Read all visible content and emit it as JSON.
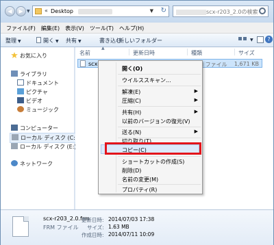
{
  "address": {
    "breadcrumb_prefix": "«",
    "location": "Desktop"
  },
  "search": {
    "placeholder_suffix": "scx-r203_2.0の検索"
  },
  "menubar": [
    "ファイル(F)",
    "編集(E)",
    "表示(V)",
    "ツール(T)",
    "ヘルプ(H)"
  ],
  "toolbar": {
    "organize": "整理",
    "open": "開く",
    "share": "共有",
    "burn": "書き込む",
    "new_folder": "新しいフォルダー"
  },
  "nav": {
    "favorites": "お気に入り",
    "libraries": "ライブラリ",
    "documents": "ドキュメント",
    "pictures": "ピクチャ",
    "videos": "ビデオ",
    "music": "ミュージック",
    "computer": "コンピューター",
    "disk_c": "ローカル ディスク (C:)",
    "disk_e": "ローカル ディスク (E:)",
    "network": "ネットワーク"
  },
  "columns": {
    "name": "名前",
    "date": "更新日時",
    "type": "種類",
    "size": "サイズ"
  },
  "file": {
    "name": "scx-r203_2.0.frm",
    "type": "FRM ファイル",
    "size": "1,671 KB"
  },
  "context_menu": {
    "open": "開く(O)",
    "virus_scan": "ウイルススキャン...",
    "extract": "解凍(E)",
    "compress": "圧縮(C)",
    "share": "共有(H)",
    "restore": "以前のバージョンの復元(V)",
    "send_to": "送る(N)",
    "cut": "切り取り(T)",
    "copy": "コピー(C)",
    "create_shortcut": "ショートカットの作成(S)",
    "delete": "削除(D)",
    "rename": "名前の変更(M)",
    "properties": "プロパティ(R)"
  },
  "details": {
    "name": "scx-r203_2.0.frm",
    "type": "FRM ファイル",
    "modified_label": "更新日時:",
    "modified": "2014/07/03 17:38",
    "size_label": "サイズ:",
    "size": "1.63 MB",
    "created_label": "作成日時:",
    "created": "2014/07/11 10:09"
  },
  "colors": {
    "highlight_border": "#e3141b",
    "selection": "#cce4fb"
  }
}
